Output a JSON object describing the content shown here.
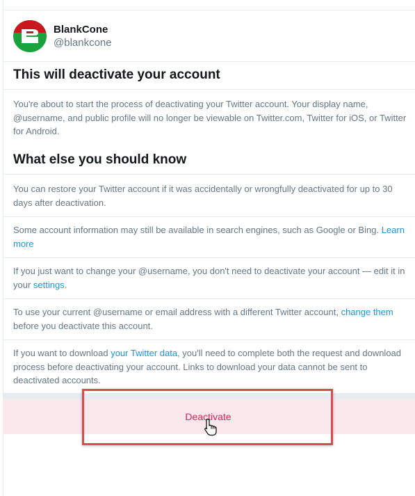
{
  "account": {
    "display_name": "BlankCone",
    "username": "@blankcone",
    "avatar_colors": {
      "top": "#c8171d",
      "bottom": "#1aa33a",
      "mark": "#ffffff"
    }
  },
  "heading_deactivate": "This will deactivate your account",
  "intro_text": "You're about to start the process of deactivating your Twitter account. Your display name, @username, and public profile will no longer be viewable on Twitter.com, Twitter for iOS, or Twitter for Android.",
  "heading_know": "What else you should know",
  "notes": {
    "restore": "You can restore your Twitter account if it was accidentally or wrongfully deactivated for up to 30 days after deactivation.",
    "search_engines_text": "Some account information may still be available in search engines, such as Google or Bing. ",
    "search_engines_link": "Learn more",
    "username_text": "If you just want to change your @username, you don't need to deactivate your account — edit it in your ",
    "username_link": "settings",
    "username_end": ".",
    "reuse_text": "To use your current @username or email address with a different Twitter account, ",
    "reuse_link": "change them",
    "reuse_end": " before you deactivate this account.",
    "download_text": "If you want to download ",
    "download_link": "your Twitter data",
    "download_end": ", you'll need to complete both the request and download process before deactivating your account. Links to download your data cannot be sent to deactivated accounts."
  },
  "deactivate_button": "Deactivate",
  "colors": {
    "link": "#1b95e0",
    "deactivate_text": "#d92458",
    "deactivate_bg": "#fbe8ec",
    "highlight_border": "#e0494b",
    "secondary_text": "#657786"
  },
  "icons": {
    "cursor": "hand-pointer-icon",
    "avatar": "blankcone-logo-icon"
  }
}
